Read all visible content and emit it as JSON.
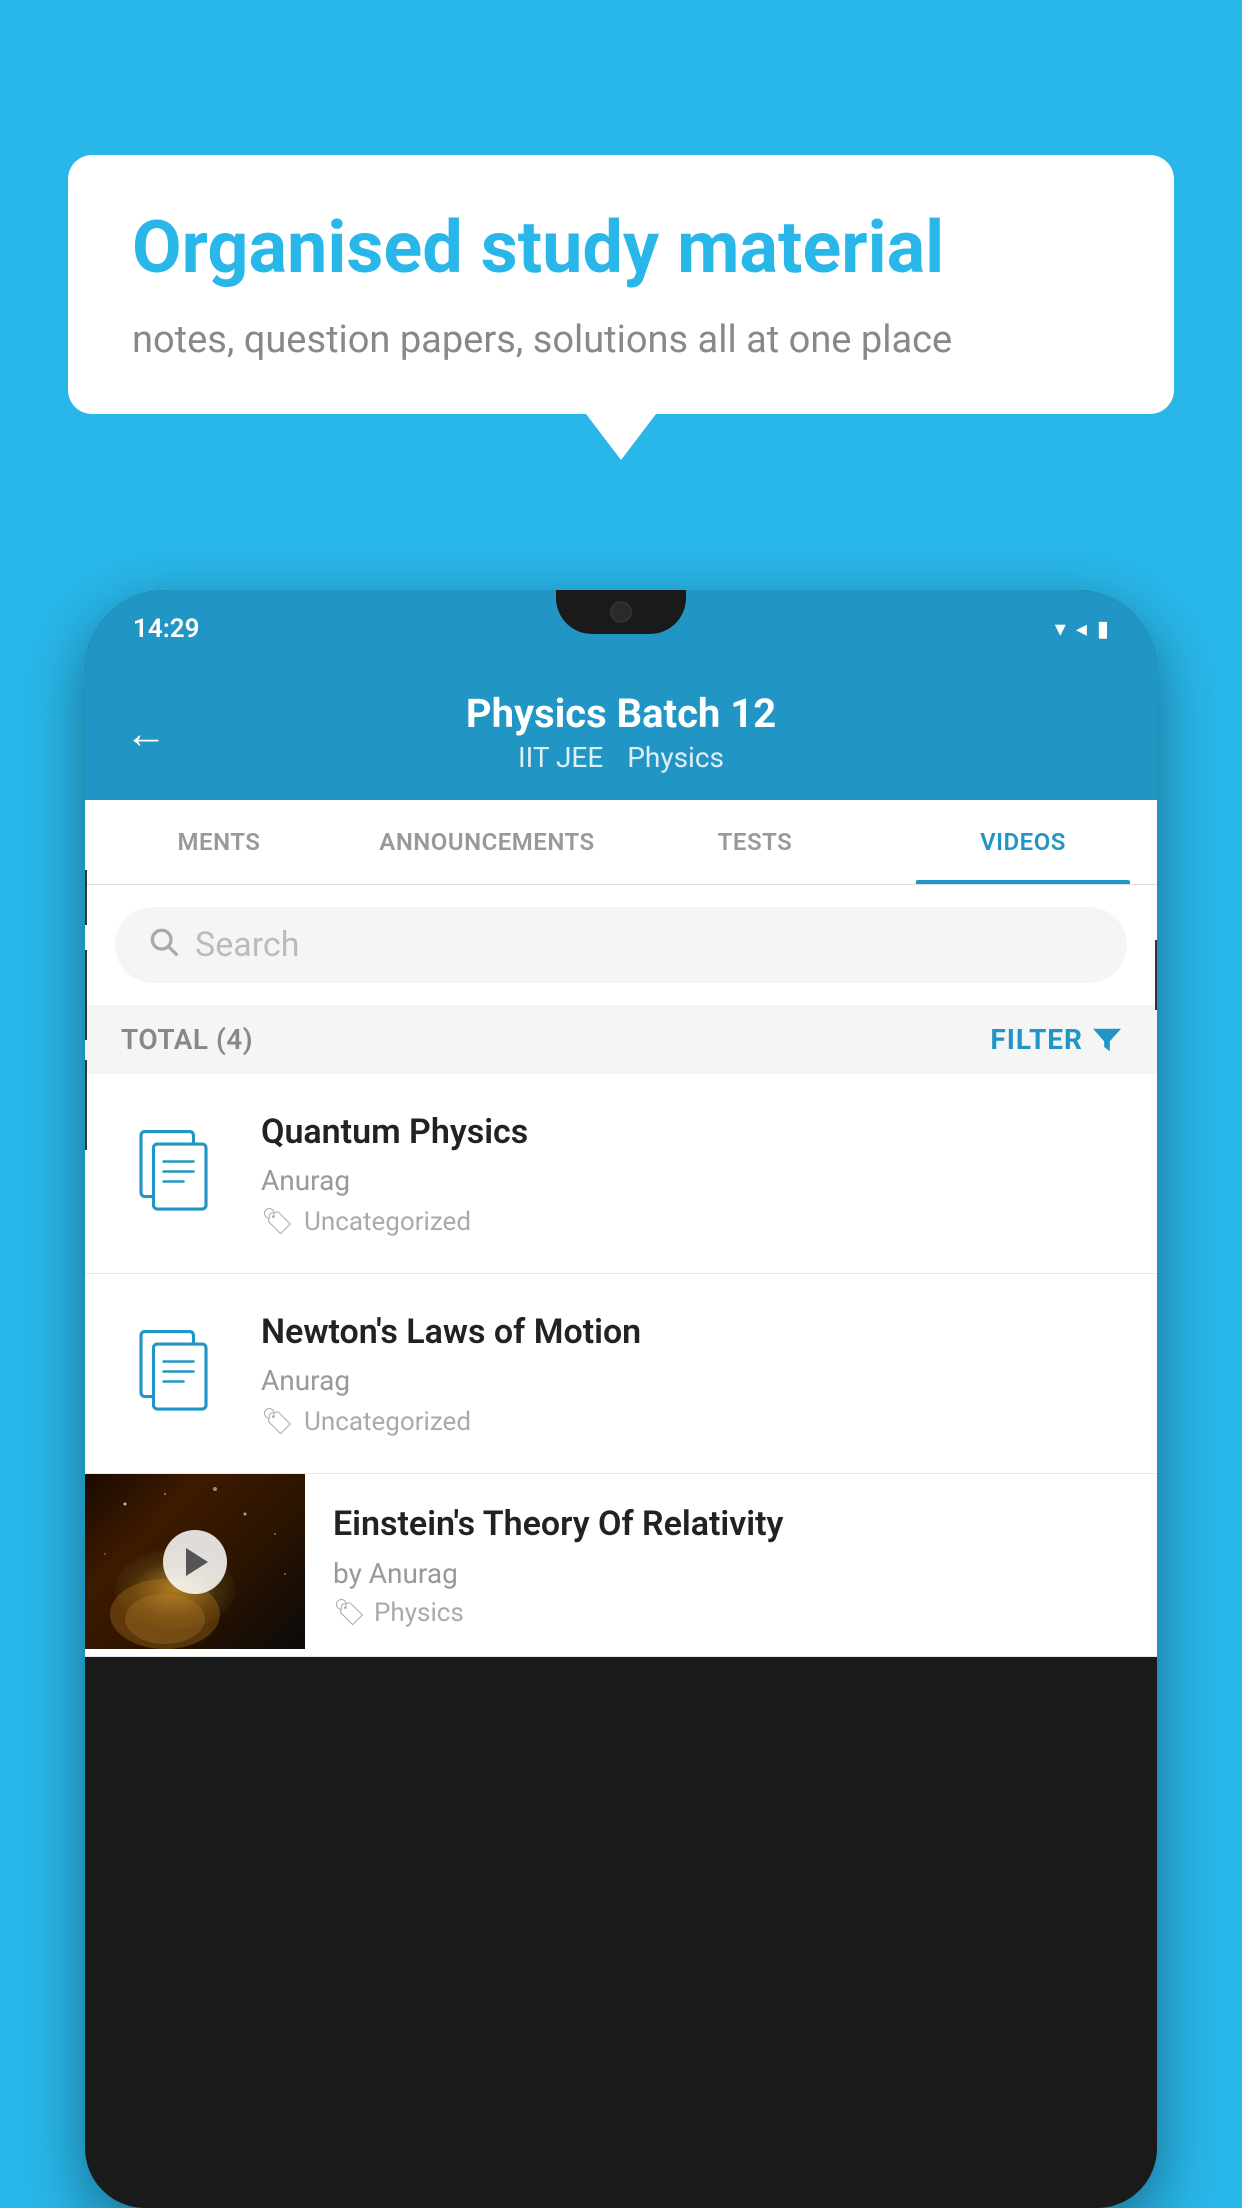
{
  "background_color": "#29b6e8",
  "speech_bubble": {
    "headline": "Organised study material",
    "subtext": "notes, question papers, solutions all at one place"
  },
  "phone": {
    "status_bar": {
      "time": "14:29",
      "icons": "▾◂▮"
    },
    "header": {
      "back_label": "←",
      "title": "Physics Batch 12",
      "subtitle_left": "IIT JEE",
      "subtitle_right": "Physics"
    },
    "tabs": [
      {
        "label": "MENTS",
        "active": false
      },
      {
        "label": "ANNOUNCEMENTS",
        "active": false
      },
      {
        "label": "TESTS",
        "active": false
      },
      {
        "label": "VIDEOS",
        "active": true
      }
    ],
    "search": {
      "placeholder": "Search"
    },
    "filter": {
      "total_label": "TOTAL (4)",
      "filter_label": "FILTER"
    },
    "video_items": [
      {
        "title": "Quantum Physics",
        "author": "Anurag",
        "tag": "Uncategorized",
        "type": "document"
      },
      {
        "title": "Newton's Laws of Motion",
        "author": "Anurag",
        "tag": "Uncategorized",
        "type": "document"
      },
      {
        "title": "Einstein's Theory Of Relativity",
        "author": "by Anurag",
        "tag": "Physics",
        "type": "video"
      }
    ]
  }
}
